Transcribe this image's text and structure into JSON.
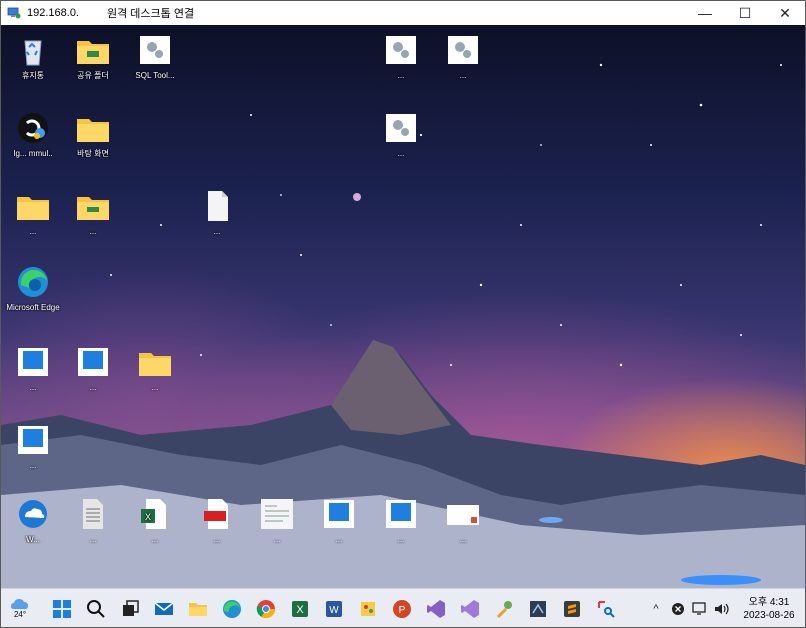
{
  "window": {
    "ip_text": "192.168.0.",
    "title": "원격 데스크톱 연결",
    "controls": {
      "minimize": "—",
      "maximize": "☐",
      "close": "✕"
    }
  },
  "desktop": {
    "icons": [
      {
        "id": "recycle-bin",
        "label": "휴지통",
        "icon": "recycle-bin-icon"
      },
      {
        "id": "folder-1",
        "label": "공유 폴더",
        "icon": "folder-icon"
      },
      {
        "id": "tool-1",
        "label": "SQL Tool...",
        "icon": "tool-icon"
      },
      {
        "id": "tool-2",
        "label": "...",
        "icon": "tool-icon"
      },
      {
        "id": "tool-3",
        "label": "...",
        "icon": "tool-icon"
      },
      {
        "id": "app-logo",
        "label": "Ig... mmul..",
        "icon": "app-logo-icon"
      },
      {
        "id": "folder-2",
        "label": "바탕 화면",
        "icon": "folder-icon"
      },
      {
        "id": "tool-4",
        "label": "...",
        "icon": "tool-icon"
      },
      {
        "id": "folder-3",
        "label": "...",
        "icon": "folder-icon"
      },
      {
        "id": "folder-4",
        "label": "...",
        "icon": "folder-icon"
      },
      {
        "id": "document",
        "label": "...",
        "icon": "document-icon"
      },
      {
        "id": "edge",
        "label": "Microsoft Edge",
        "icon": "edge-icon"
      },
      {
        "id": "app-blue-1",
        "label": "...",
        "icon": "app-window-icon"
      },
      {
        "id": "app-blue-2",
        "label": "...",
        "icon": "app-window-icon"
      },
      {
        "id": "folder-5",
        "label": "...",
        "icon": "folder-icon"
      },
      {
        "id": "app-blue-3",
        "label": "...",
        "icon": "app-window-icon"
      },
      {
        "id": "shortcut-cloud",
        "label": "W...",
        "icon": "cloud-icon"
      },
      {
        "id": "text-file",
        "label": "...",
        "icon": "text-file-icon"
      },
      {
        "id": "excel-file",
        "label": "...",
        "icon": "excel-file-icon"
      },
      {
        "id": "pdf-file",
        "label": "...",
        "icon": "pdf-file-icon"
      },
      {
        "id": "doc-file",
        "label": "...",
        "icon": "doc-file-icon"
      },
      {
        "id": "app-blue-4",
        "label": "...",
        "icon": "app-window-icon"
      },
      {
        "id": "app-blue-5",
        "label": "...",
        "icon": "app-window-icon"
      },
      {
        "id": "window-app",
        "label": "...",
        "icon": "window-app-icon"
      }
    ]
  },
  "taskbar": {
    "weather": {
      "temp": "24°",
      "icon": "weather-cloud-icon"
    },
    "apps": [
      {
        "id": "start",
        "icon": "windows-start-icon"
      },
      {
        "id": "search",
        "icon": "search-icon"
      },
      {
        "id": "task-view",
        "icon": "task-view-icon"
      },
      {
        "id": "mail",
        "icon": "mail-icon"
      },
      {
        "id": "explorer",
        "icon": "file-explorer-icon"
      },
      {
        "id": "edge",
        "icon": "edge-icon"
      },
      {
        "id": "chrome",
        "icon": "chrome-icon"
      },
      {
        "id": "excel",
        "icon": "excel-icon"
      },
      {
        "id": "word",
        "icon": "word-icon"
      },
      {
        "id": "paint",
        "icon": "paint-icon"
      },
      {
        "id": "powerpoint",
        "icon": "powerpoint-icon"
      },
      {
        "id": "visual-studio",
        "icon": "visual-studio-icon"
      },
      {
        "id": "visual-studio-2",
        "icon": "visual-studio-preview-icon"
      },
      {
        "id": "tool-app",
        "icon": "tool-app-icon"
      },
      {
        "id": "ssms",
        "icon": "ssms-icon"
      },
      {
        "id": "sublime",
        "icon": "sublime-icon"
      },
      {
        "id": "snipping",
        "icon": "snipping-tool-icon"
      }
    ],
    "tray": {
      "chevron": "^",
      "time_period": "오후 4:31",
      "date": "2023-08-26"
    }
  },
  "colors": {
    "taskbar_bg": "#e9edf3",
    "accent_blue": "#0a64c8",
    "folder_yellow": "#f5c542"
  }
}
